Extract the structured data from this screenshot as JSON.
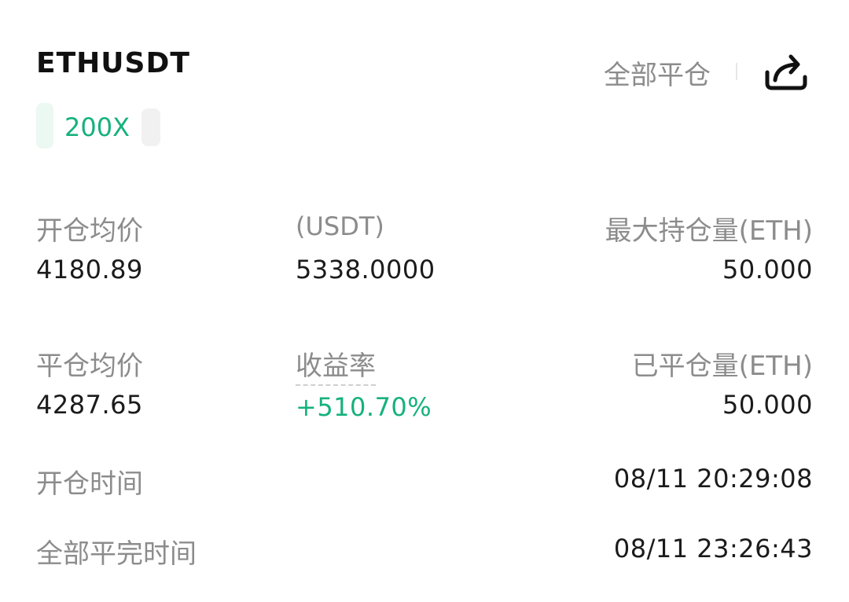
{
  "header": {
    "symbol": "ETHUSDT",
    "close_all_label": "全部平仓",
    "share_icon": "share-icon"
  },
  "tag": {
    "leverage": "200X"
  },
  "stats": {
    "row1": {
      "open_avg_label": "开仓均价",
      "open_avg_value": "4180.89",
      "usdt_label": "(USDT)",
      "usdt_value": "5338.0000",
      "max_pos_label": "最大持仓量(ETH)",
      "max_pos_value": "50.000"
    },
    "row2": {
      "close_avg_label": "平仓均价",
      "close_avg_value": "4287.65",
      "yield_label": "收益率",
      "yield_value": "+510.70%",
      "closed_pos_label": "已平仓量(ETH)",
      "closed_pos_value": "50.000"
    }
  },
  "times": {
    "open_time_label": "开仓时间",
    "open_time_value": "08/11 20:29:08",
    "close_time_label": "全部平完时间",
    "close_time_value": "08/11 23:26:43"
  },
  "colors": {
    "accent_green": "#16b17d",
    "label_gray": "#8c8c8c",
    "text_dark": "#1b1b1b"
  }
}
